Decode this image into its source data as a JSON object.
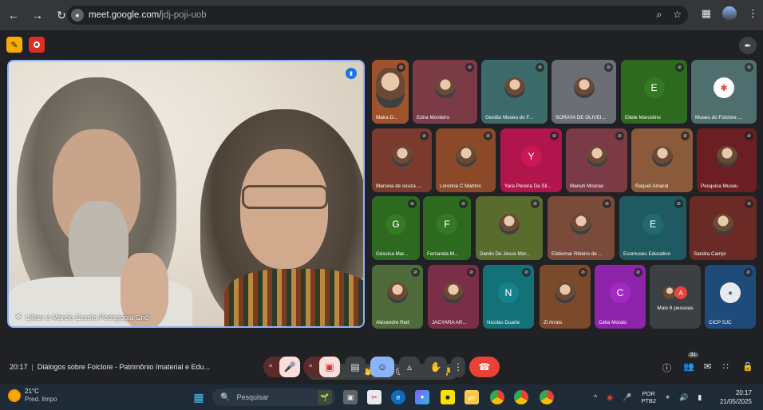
{
  "browser": {
    "url_host": "meet.google.com/",
    "url_path": "jdj-poji-uob"
  },
  "main_tile": {
    "label": "Lillian e Márcio Escola Pedagogia Griô"
  },
  "participants": [
    {
      "name": "Maira D...",
      "kind": "photo",
      "bg": "#a0522d"
    },
    {
      "name": "Edna Monteiro",
      "kind": "photo",
      "bg": "#7a3b47"
    },
    {
      "name": "Gestão Museu do F...",
      "kind": "photo",
      "bg": "#3d6b6b"
    },
    {
      "name": "SORAYA DE OLIVEI...",
      "kind": "photo",
      "bg": "#6b6f75"
    },
    {
      "name": "Eliete Marcelino",
      "kind": "letter",
      "letter": "E",
      "bg": "#2d6a1f"
    },
    {
      "name": "Museu do Folclore ...",
      "kind": "logo",
      "bg": "#4f6f6f"
    },
    {
      "name": "Marcela de souza ...",
      "kind": "photo",
      "bg": "#7a3b2e"
    },
    {
      "name": "Lorenna C Martins",
      "kind": "photo",
      "bg": "#8a4a2a"
    },
    {
      "name": "Yara Pereira Da Sil...",
      "kind": "letter",
      "letter": "Y",
      "bg": "#b0154b"
    },
    {
      "name": "Manuh Mourao",
      "kind": "photo",
      "bg": "#7a3b47"
    },
    {
      "name": "Raquel Amaral",
      "kind": "photo",
      "bg": "#8a5a3a"
    },
    {
      "name": "Pesquisa Museu",
      "kind": "photo",
      "bg": "#6b1f22"
    },
    {
      "name": "Géssica Mar...",
      "kind": "letter",
      "letter": "G",
      "bg": "#2d6a1f"
    },
    {
      "name": "Fernanda M...",
      "kind": "letter",
      "letter": "F",
      "bg": "#2d6a1f"
    },
    {
      "name": "Danilo De Jesus Mor...",
      "kind": "photo",
      "bg": "#5a6b2e"
    },
    {
      "name": "Elidiomar Ribeiro de ...",
      "kind": "photo",
      "bg": "#7a4a3a"
    },
    {
      "name": "Ecomuseu Educativo",
      "kind": "letter",
      "letter": "E",
      "bg": "#1f5a62"
    },
    {
      "name": "Sandra Campi",
      "kind": "photo",
      "bg": "#6b2a25"
    },
    {
      "name": "Alexandre Red",
      "kind": "photo",
      "bg": "#4f6b3a"
    },
    {
      "name": "JACYARA AR...",
      "kind": "photo",
      "bg": "#7a2e47"
    },
    {
      "name": "Nicolas Duarte",
      "kind": "letter",
      "letter": "N",
      "bg": "#137178"
    },
    {
      "name": "Zl Arrais",
      "kind": "photo",
      "bg": "#7a4a2a"
    },
    {
      "name": "Celia Morais",
      "kind": "letter",
      "letter": "C",
      "bg": "#8e24aa"
    },
    {
      "name": "Mais 6 pessoas",
      "kind": "more",
      "letter": "A",
      "bg": "#3c4043"
    },
    {
      "name": "CICP SJC",
      "kind": "logo2",
      "bg": "#1f4b7a"
    }
  ],
  "meeting": {
    "time": "20:17",
    "title": "Diálogos sobre Folclore - Patrimônio Imaterial e Edu..."
  },
  "controls": {
    "people_count": "31"
  },
  "reactions": [
    "💖",
    "👍",
    "🎉",
    "👏",
    "😂",
    "😮",
    "😢",
    "🤔",
    "👎"
  ],
  "taskbar": {
    "weather_temp": "21°C",
    "weather_desc": "Pred. limpo",
    "search_placeholder": "Pesquisar",
    "lang_1": "POR",
    "lang_2": "PTB2",
    "clock_time": "20:17",
    "clock_date": "21/05/2025"
  }
}
